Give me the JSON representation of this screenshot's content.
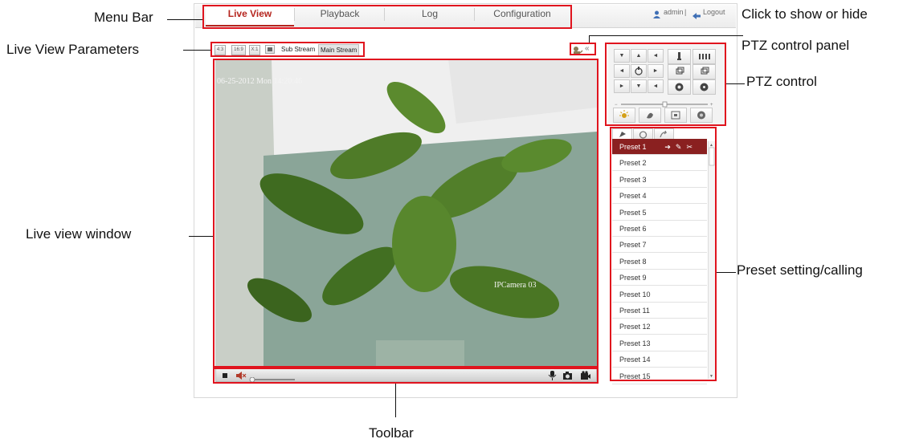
{
  "callouts": {
    "menu_bar": "Menu Bar",
    "live_view_parameters": "Live View Parameters",
    "click_to_show": "Click to show or hide",
    "ptz_control_panel": "PTZ control panel",
    "ptz_control": "PTZ control",
    "live_view_window": "Live view window",
    "preset_setting": "Preset setting/calling",
    "toolbar": "Toolbar"
  },
  "menu": {
    "tabs": [
      "Live View",
      "Playback",
      "Log",
      "Configuration"
    ],
    "active_tab": "Live View",
    "user": "admin",
    "separator": "|",
    "logout": "Logout"
  },
  "params": {
    "buttons": [
      "4:3",
      "16:9",
      "X:1",
      "auto"
    ],
    "sub_stream": "Sub Stream",
    "main_stream": "Main Stream",
    "collapse": "«"
  },
  "video": {
    "timestamp": "06-25-2012 Mon 14:20:46",
    "camera_name": "IPCamera 03"
  },
  "toolbar": {
    "volume_level": 0.0
  },
  "presets": [
    "Preset 1",
    "Preset 2",
    "Preset 3",
    "Preset 4",
    "Preset 5",
    "Preset 6",
    "Preset 7",
    "Preset 8",
    "Preset 9",
    "Preset 10",
    "Preset 11",
    "Preset 12",
    "Preset 13",
    "Preset 14",
    "Preset 15"
  ],
  "colors": {
    "highlight": "#e0141e",
    "active_tab": "#b5251e",
    "selected_preset": "#8a2020"
  }
}
